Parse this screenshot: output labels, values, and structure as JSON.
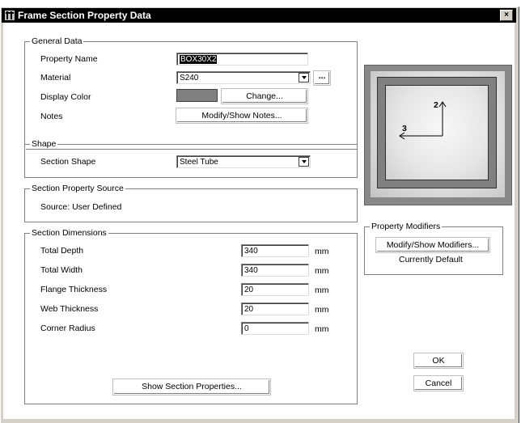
{
  "window": {
    "title": "Frame Section Property Data",
    "close_label": "×"
  },
  "general_data": {
    "legend": "General Data",
    "property_name_label": "Property Name",
    "property_name_value": "BOX30X2",
    "material_label": "Material",
    "material_value": "S240",
    "material_browse_label": "...",
    "display_color_label": "Display Color",
    "display_color": "#808080",
    "change_button_label": "Change...",
    "notes_label": "Notes",
    "notes_button_label": "Modify/Show Notes..."
  },
  "shape": {
    "legend": "Shape",
    "section_shape_label": "Section Shape",
    "section_shape_value": "Steel Tube"
  },
  "source": {
    "legend": "Section Property Source",
    "text": "Source:  User Defined"
  },
  "dimensions": {
    "legend": "Section Dimensions",
    "rows": [
      {
        "label": "Total Depth",
        "value": "340",
        "unit": "mm"
      },
      {
        "label": "Total Width",
        "value": "340",
        "unit": "mm"
      },
      {
        "label": "Flange Thickness",
        "value": "20",
        "unit": "mm"
      },
      {
        "label": "Web Thickness",
        "value": "20",
        "unit": "mm"
      },
      {
        "label": "Corner Radius",
        "value": "0",
        "unit": "mm"
      }
    ],
    "show_props_button_label": "Show Section Properties..."
  },
  "preview": {
    "axis_2_label": "2",
    "axis_3_label": "3"
  },
  "modifiers": {
    "legend": "Property Modifiers",
    "button_label": "Modify/Show Modifiers...",
    "status_text": "Currently Default"
  },
  "actions": {
    "ok_label": "OK",
    "cancel_label": "Cancel"
  }
}
